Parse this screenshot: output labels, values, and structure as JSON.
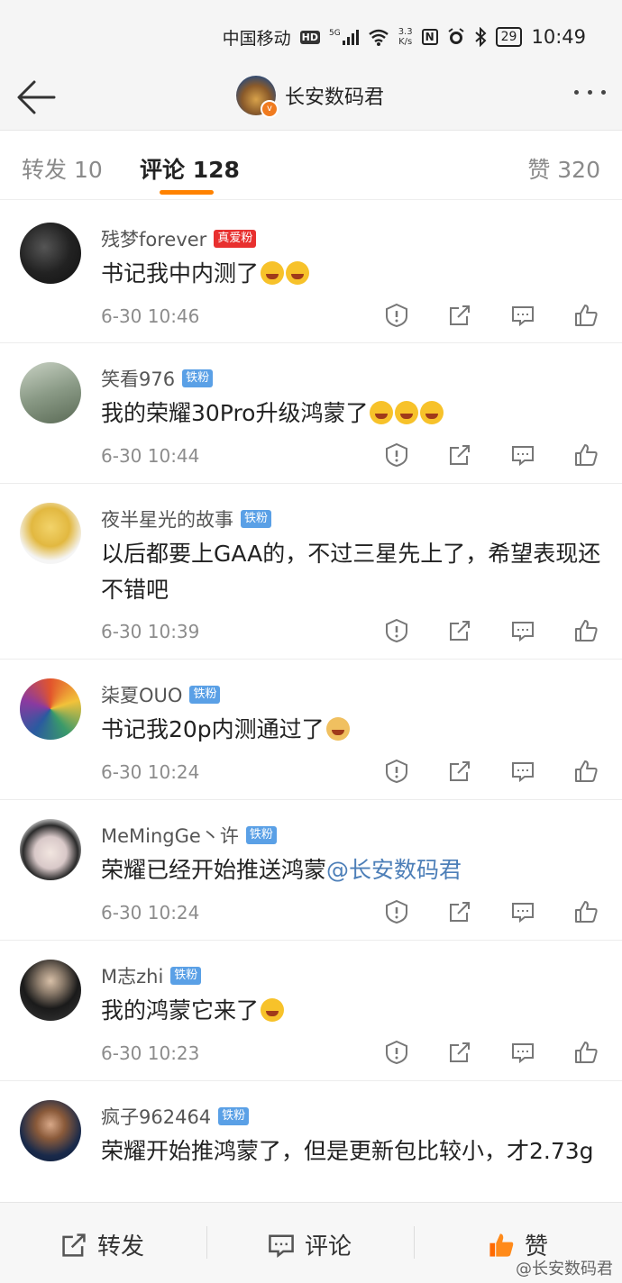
{
  "status": {
    "carrier": "中国移动",
    "hd": "HD",
    "net": "5G",
    "speed_top": "3.3",
    "speed_bottom": "K/s",
    "nfc": "N",
    "battery": "29",
    "time": "10:49"
  },
  "header": {
    "title": "长安数码君"
  },
  "tabs": [
    {
      "label": "转发 10"
    },
    {
      "label": "评论 128"
    },
    {
      "label": "赞 320"
    }
  ],
  "comments": [
    {
      "user": "残梦forever",
      "badge": "真爱粉",
      "text": "书记我中内测了",
      "time": "6-30 10:46"
    },
    {
      "user": "笑看976",
      "badge": "铁粉",
      "text": "我的荣耀30Pro升级鸿蒙了",
      "time": "6-30 10:44"
    },
    {
      "user": "夜半星光的故事",
      "badge": "铁粉",
      "text": "以后都要上GAA的，不过三星先上了，希望表现还不错吧",
      "time": "6-30 10:39"
    },
    {
      "user": "柒夏OUO",
      "badge": "铁粉",
      "text": "书记我20p内测通过了",
      "time": "6-30 10:24"
    },
    {
      "user": "MeMingGe丶许",
      "badge": "铁粉",
      "text": "荣耀已经开始推送鸿蒙",
      "mention": "@长安数码君",
      "time": "6-30 10:24"
    },
    {
      "user": "M志zhi",
      "badge": "铁粉",
      "text": "我的鸿蒙它来了",
      "time": "6-30 10:23"
    },
    {
      "user": "疯子962464",
      "badge": "铁粉",
      "text": "荣耀开始推鸿蒙了，但是更新包比较小，才2.73g",
      "time": ""
    }
  ],
  "bottom": {
    "repost": "转发",
    "comment": "评论",
    "like": "赞"
  },
  "watermark": "@长安数码君",
  "colors": {
    "accent": "#ff8200",
    "mention": "#4d7fb8",
    "badge_red": "#e8302f",
    "badge_blue": "#5aa0e6"
  }
}
